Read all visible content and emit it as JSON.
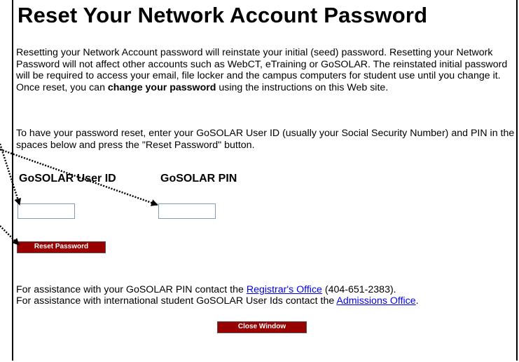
{
  "title": "Reset Your Network Account Password",
  "intro": {
    "part1": "Resetting your Network Account password will reinstate your initial (seed) password. Resetting your Network Password will not affect other accounts such as WebCT, eTraining or GoSOLAR. The reinstated initial password will be required to access your email, file locker and the campus computers for student use until you change it. Once reset, you can ",
    "bold": "change your password",
    "part2": " using the instructions on this Web site."
  },
  "instructions": "To have your password reset, enter your GoSOLAR User ID (usually your Social Security Number) and PIN in the spaces below and press the \"Reset Password\" button.",
  "form": {
    "user_id_label": "GoSOLAR User ID",
    "pin_label": "GoSOLAR PIN",
    "user_id_value": "",
    "pin_value": "",
    "reset_button": "Reset Password"
  },
  "assistance": {
    "line1_before": "For assistance with your GoSOLAR PIN contact the ",
    "line1_link": "Registrar's Office",
    "line1_after": " (404-651-2383).",
    "line2_before": "For assistance with international student GoSOLAR User Ids contact the ",
    "line2_link": "Admissions Office",
    "line2_after": "."
  },
  "close_button": "Close Window",
  "colors": {
    "button_bg": "#990000",
    "link": "#0000ee"
  }
}
